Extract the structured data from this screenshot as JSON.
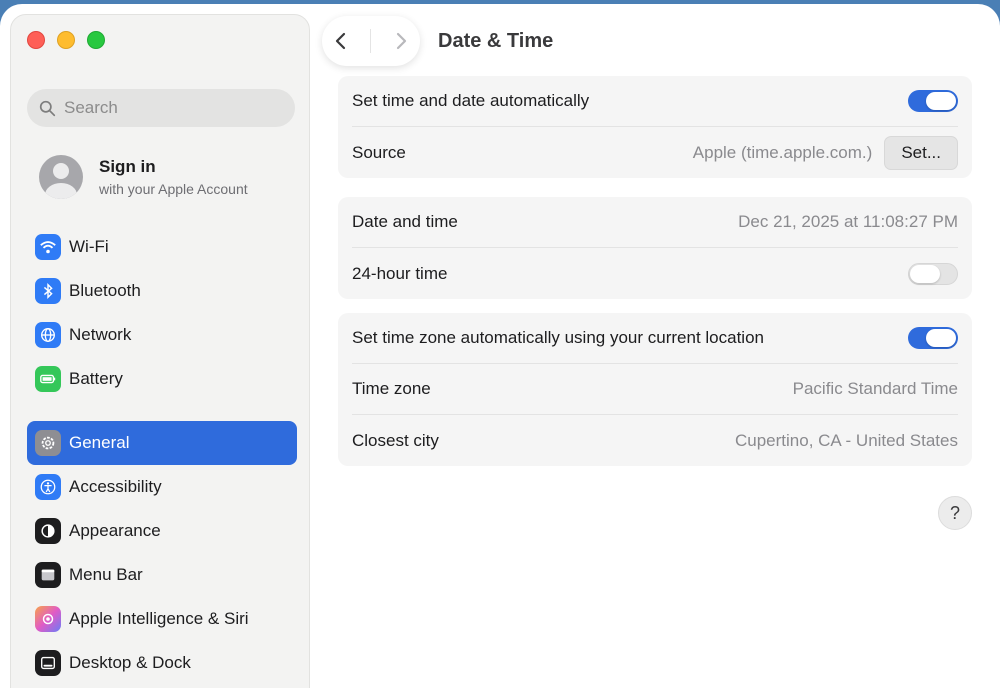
{
  "sidebar": {
    "search_placeholder": "Search",
    "account": {
      "title": "Sign in",
      "subtitle": "with your Apple Account"
    },
    "items": [
      {
        "label": "Wi-Fi",
        "icon": "wifi-icon",
        "color": "#2f7bf6"
      },
      {
        "label": "Bluetooth",
        "icon": "bluetooth-icon",
        "color": "#2f7bf6"
      },
      {
        "label": "Network",
        "icon": "globe-icon",
        "color": "#2f7bf6"
      },
      {
        "label": "Battery",
        "icon": "battery-icon",
        "color": "#34c759"
      },
      {
        "label": "General",
        "icon": "gear-icon",
        "color": "#8e8e93",
        "active": true
      },
      {
        "label": "Accessibility",
        "icon": "accessibility-icon",
        "color": "#2f7bf6"
      },
      {
        "label": "Appearance",
        "icon": "appearance-icon",
        "color": "#1d1d1f"
      },
      {
        "label": "Menu Bar",
        "icon": "menu-bar-icon",
        "color": "#1d1d1f"
      },
      {
        "label": "Apple Intelligence & Siri",
        "icon": "siri-icon",
        "color": "#c86dd7"
      },
      {
        "label": "Desktop & Dock",
        "icon": "dock-icon",
        "color": "#1d1d1f"
      }
    ]
  },
  "header": {
    "title": "Date & Time"
  },
  "groups": {
    "auto": {
      "auto_label": "Set time and date automatically",
      "auto_on": true,
      "source_label": "Source",
      "source_value": "Apple (time.apple.com.)",
      "set_button": "Set..."
    },
    "datetime": {
      "datetime_label": "Date and time",
      "datetime_value": "Dec 21, 2025 at 11:08:27 PM",
      "hour24_label": "24-hour time",
      "hour24_on": false
    },
    "timezone": {
      "tz_auto_label": "Set time zone automatically using your current location",
      "tz_auto_on": true,
      "tz_label": "Time zone",
      "tz_value": "Pacific Standard Time",
      "city_label": "Closest city",
      "city_value": "Cupertino, CA - United States"
    }
  },
  "help": "?",
  "accent_color": "#2f6bdc"
}
